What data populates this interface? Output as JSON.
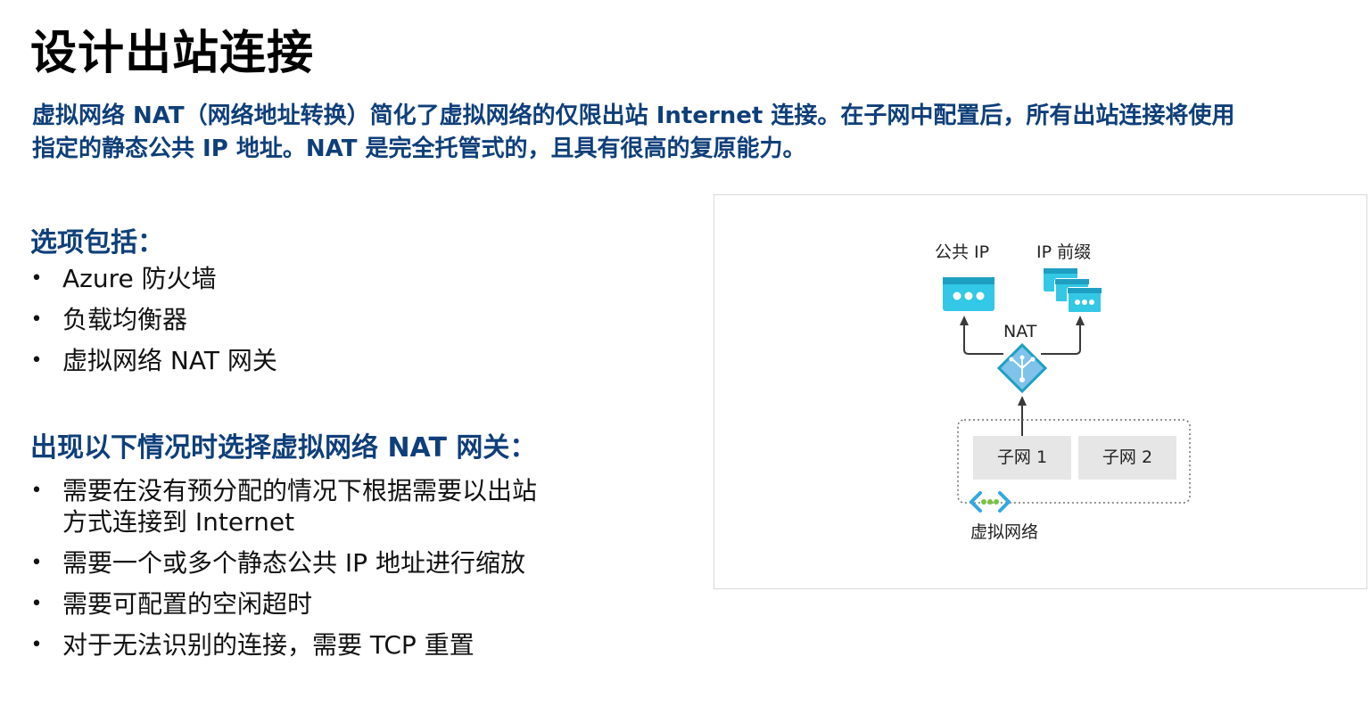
{
  "slide": {
    "title": "设计出站连接",
    "intro": {
      "line1": "虚拟网络 NAT（网络地址转换）简化了虚拟网络的仅限出站 Internet 连接。在子网中配置后，所有出站连接将使用",
      "line2": "指定的静态公共 IP 地址。NAT 是完全托管式的，且具有很高的复原能力。"
    },
    "options": {
      "heading": "选项包括：",
      "items": [
        "Azure 防火墙",
        "负载均衡器",
        "虚拟网络 NAT 网关"
      ]
    },
    "when": {
      "heading": "出现以下情况时选择虚拟网络 NAT 网关：",
      "item0_line1": "需要在没有预分配的情况下根据需要以出站",
      "item0_line2": "方式连接到 Internet",
      "items": [
        "需要一个或多个静态公共 IP 地址进行缩放",
        "需要可配置的空闲超时",
        "对于无法识别的连接，需要 TCP 重置"
      ]
    },
    "bullet_char": "•"
  },
  "diagram": {
    "public_ip_label": "公共 IP",
    "ip_prefix_label": "IP 前缀",
    "nat_label": "NAT",
    "subnet1": "子网 1",
    "subnet2": "子网 2",
    "vnet_label": "虚拟网络",
    "icons": [
      "public-ip-icon",
      "ip-prefix-icon",
      "nat-gateway-icon",
      "virtual-network-icon"
    ],
    "colors": {
      "azure_cyan": "#32c8e6",
      "nat_diamond": "#7fc2ea",
      "vnet_green": "#7ac143",
      "heading_blue": "#0f3f7a"
    }
  }
}
